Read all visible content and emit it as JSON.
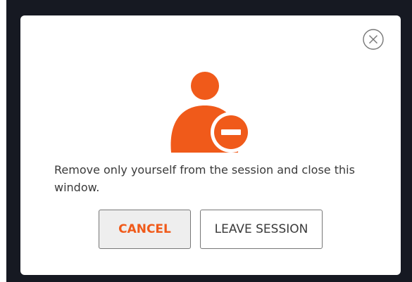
{
  "dialog": {
    "message": "Remove only yourself from the session and close this window.",
    "cancel_label": "CANCEL",
    "leave_label": "LEAVE SESSION",
    "close_icon": "circle-x-icon",
    "main_icon": "remove-user-icon"
  },
  "colors": {
    "accent": "#f05a1a",
    "backdrop": "#161922",
    "text": "#3a3a3a"
  }
}
